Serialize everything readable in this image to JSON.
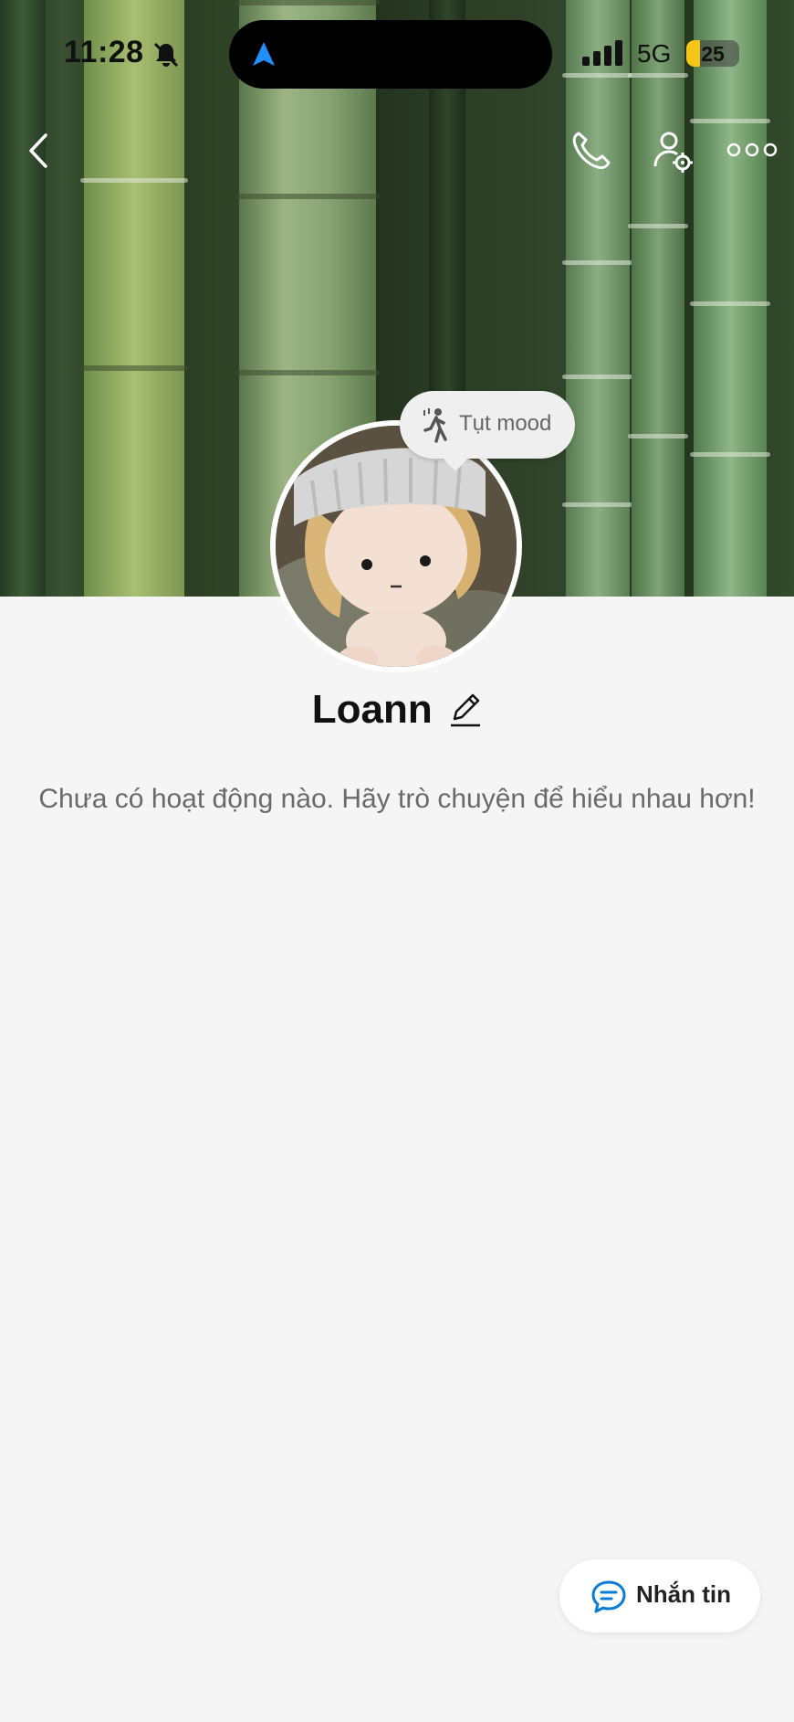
{
  "status_bar": {
    "time": "11:28",
    "silent_icon": "bell-slash-icon",
    "navigation_icon": "location-arrow-icon",
    "network": "5G",
    "battery_percent": "25",
    "battery_level": 0.25
  },
  "header": {
    "back_icon": "chevron-left-icon",
    "call_icon": "phone-icon",
    "settings_icon": "user-gear-icon",
    "more_icon": "ellipsis-icon"
  },
  "profile": {
    "name": "Loann",
    "mood": "Tụt mood",
    "mood_icon": "person-walking-icon",
    "edit_icon": "pencil-icon",
    "empty_message": "Chưa có hoạt động nào. Hãy trò chuyện để hiểu nhau hơn!"
  },
  "actions": {
    "message_label": "Nhắn tin",
    "message_icon": "chat-bubble-icon"
  },
  "colors": {
    "accent": "#0b7cd4",
    "background": "#f5f5f5",
    "battery": "#f5c518"
  }
}
